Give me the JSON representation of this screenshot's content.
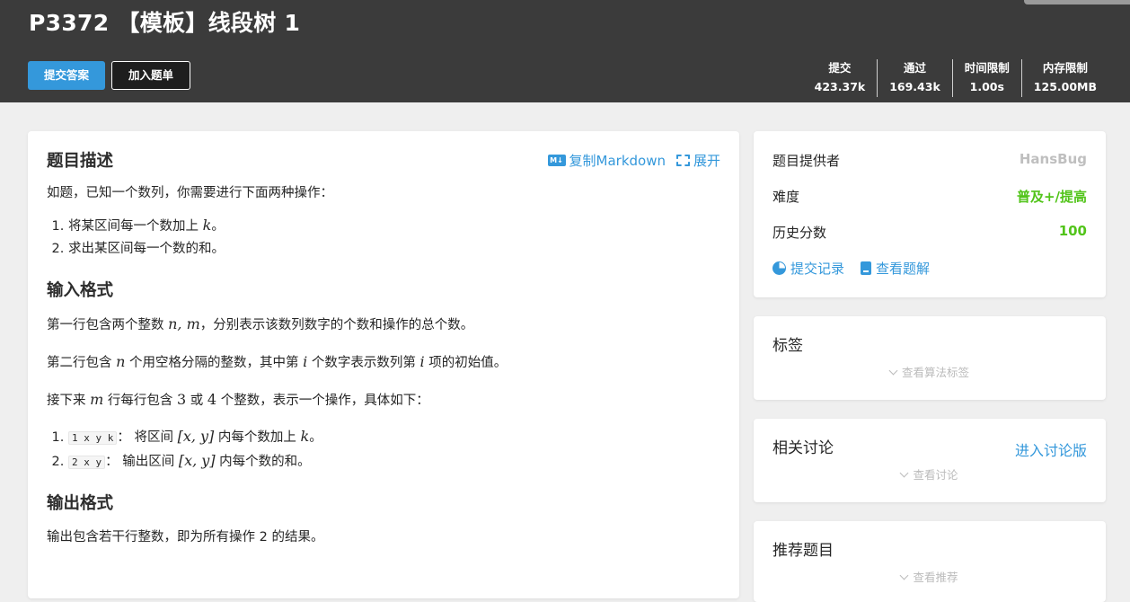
{
  "header": {
    "title": "P3372 【模板】线段树 1",
    "submit_label": "提交答案",
    "add_list_label": "加入题单",
    "stats": [
      {
        "label": "提交",
        "value": "423.37k"
      },
      {
        "label": "通过",
        "value": "169.43k"
      },
      {
        "label": "时间限制",
        "value": "1.00s"
      },
      {
        "label": "内存限制",
        "value": "125.00MB"
      }
    ]
  },
  "main": {
    "copy_markdown": "复制Markdown",
    "md_badge": "M↓",
    "expand": "展开",
    "desc_title": "题目描述",
    "desc_intro": "如题，已知一个数列，你需要进行下面两种操作：",
    "desc_op1_pre": "将某区间每一个数加上 ",
    "desc_op1_var": "k",
    "desc_op1_post": "。",
    "desc_op2": "求出某区间每一个数的和。",
    "input_title": "输入格式",
    "in_p1_a": "第一行包含两个整数 ",
    "in_p1_var": "n, m",
    "in_p1_b": "，分别表示该数列数字的个数和操作的总个数。",
    "in_p2_a": "第二行包含 ",
    "in_p2_var1": "n",
    "in_p2_b": " 个用空格分隔的整数，其中第 ",
    "in_p2_var2": "i",
    "in_p2_c": " 个数字表示数列第 ",
    "in_p2_var3": "i",
    "in_p2_d": " 项的初始值。",
    "in_p3_a": "接下来 ",
    "in_p3_var1": "m",
    "in_p3_b": " 行每行包含 ",
    "in_p3_n1": "3",
    "in_p3_c": " 或 ",
    "in_p3_n2": "4",
    "in_p3_d": " 个整数，表示一个操作，具体如下：",
    "op1_code": "1 x y k",
    "op1_a": "： 将区间 ",
    "op1_var": "[x, y]",
    "op1_b": " 内每个数加上 ",
    "op1_var2": "k",
    "op1_c": "。",
    "op2_code": "2 x y",
    "op2_a": "： 输出区间 ",
    "op2_var": "[x, y]",
    "op2_b": " 内每个数的和。",
    "output_title": "输出格式",
    "out_p1": "输出包含若干行整数，即为所有操作 2 的结果。"
  },
  "side": {
    "provider_label": "题目提供者",
    "provider_value": "HansBug",
    "difficulty_label": "难度",
    "difficulty_value": "普及+/提高",
    "score_label": "历史分数",
    "score_value": "100",
    "records_link": "提交记录",
    "solutions_link": "查看题解",
    "tags_title": "标签",
    "tags_more": "查看算法标签",
    "discuss_title": "相关讨论",
    "discuss_link": "进入讨论版",
    "discuss_more": "查看讨论",
    "recommend_title": "推荐题目",
    "recommend_more": "查看推荐"
  },
  "colors": {
    "header_bg": "#3b3b3b",
    "accent": "#3498db",
    "green": "#52c41a",
    "page_bg": "#efefef"
  }
}
